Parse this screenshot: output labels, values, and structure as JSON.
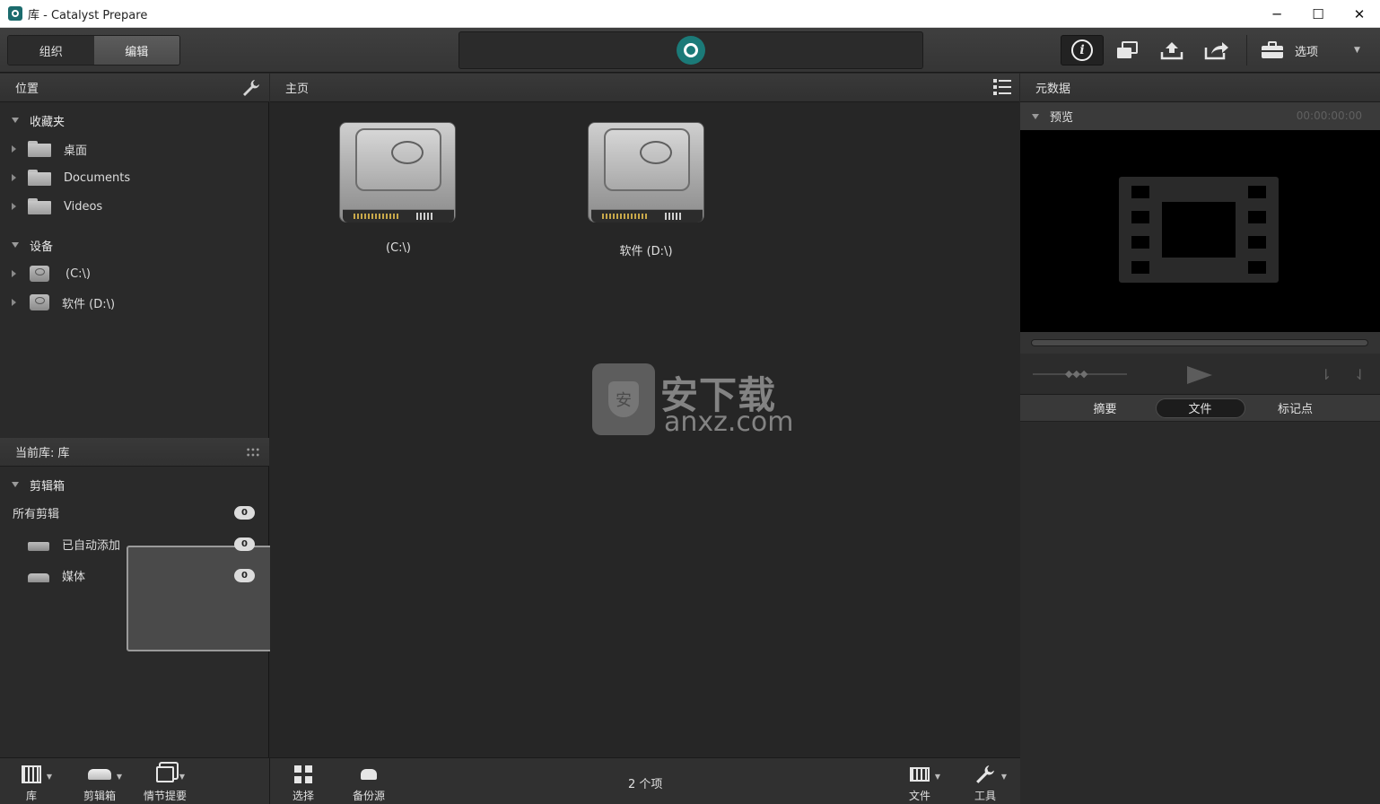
{
  "window": {
    "title": "库 - Catalyst Prepare",
    "controls": {
      "minimize": "─",
      "maximize": "☐",
      "close": "✕"
    }
  },
  "toolbar": {
    "mode_tabs": [
      {
        "label": "组织",
        "active": false
      },
      {
        "label": "编辑",
        "active": true
      }
    ],
    "info_label": "i",
    "options_label": "选项"
  },
  "left_panel": {
    "location_title": "位置",
    "favorites": {
      "label": "收藏夹",
      "items": [
        "桌面",
        "Documents",
        "Videos"
      ]
    },
    "devices": {
      "label": "设备",
      "items": [
        "(C:\\)",
        "软件 (D:\\)"
      ]
    },
    "library_title": "当前库: 库",
    "bins": {
      "label": "剪辑箱",
      "items": [
        {
          "label": "所有剪辑",
          "count": "0"
        },
        {
          "label": "已自动添加",
          "count": "0"
        },
        {
          "label": "媒体",
          "count": "0"
        }
      ]
    }
  },
  "center_panel": {
    "title": "主页",
    "drives": [
      {
        "label": "(C:\\)"
      },
      {
        "label": "软件 (D:\\)"
      }
    ],
    "item_count": "2 个项"
  },
  "watermark": {
    "text": "安下载",
    "sub": "anxz.com",
    "shield_char": "安"
  },
  "right_panel": {
    "title": "元数据",
    "preview_label": "预览",
    "timecode": "00:00:00:00",
    "tabs": [
      {
        "label": "摘要",
        "active": false
      },
      {
        "label": "文件",
        "active": true
      },
      {
        "label": "标记点",
        "active": false
      }
    ]
  },
  "bottom_bar": {
    "left": [
      {
        "label": "库",
        "icon": "library-icon"
      },
      {
        "label": "剪辑箱",
        "icon": "bin-icon"
      },
      {
        "label": "情节提要",
        "icon": "storyboard-icon"
      }
    ],
    "center": [
      {
        "label": "选择",
        "icon": "grid-icon"
      },
      {
        "label": "备份源",
        "icon": "backup-icon"
      }
    ],
    "right": [
      {
        "label": "文件",
        "icon": "film-icon"
      },
      {
        "label": "工具",
        "icon": "wrench-icon"
      }
    ]
  }
}
